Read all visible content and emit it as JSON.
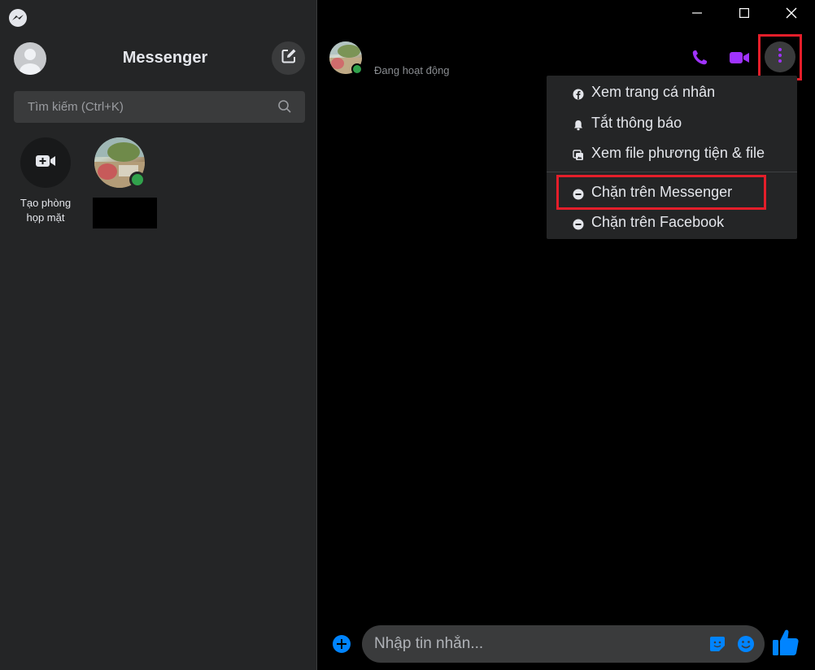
{
  "sidebar": {
    "title": "Messenger",
    "search_placeholder": "Tìm kiếm (Ctrl+K)",
    "create_room_label": "Tạo phòng\nhọp mặt"
  },
  "chat": {
    "status": "Đang hoạt động",
    "composer_placeholder": "Nhập tin nhắn..."
  },
  "menu": {
    "items": [
      {
        "label": "Xem trang cá nhân",
        "icon": "facebook-icon"
      },
      {
        "label": "Tắt thông báo",
        "icon": "bell-icon"
      },
      {
        "label": "Xem file phương tiện & file",
        "icon": "media-files-icon"
      },
      {
        "label": "Chặn trên Messenger",
        "icon": "block-icon"
      },
      {
        "label": "Chặn trên Facebook",
        "icon": "block-icon"
      }
    ]
  },
  "colors": {
    "accent": "#a033ff",
    "messenger_blue": "#0084ff",
    "online": "#31a24c",
    "highlight": "#e41e2a"
  }
}
